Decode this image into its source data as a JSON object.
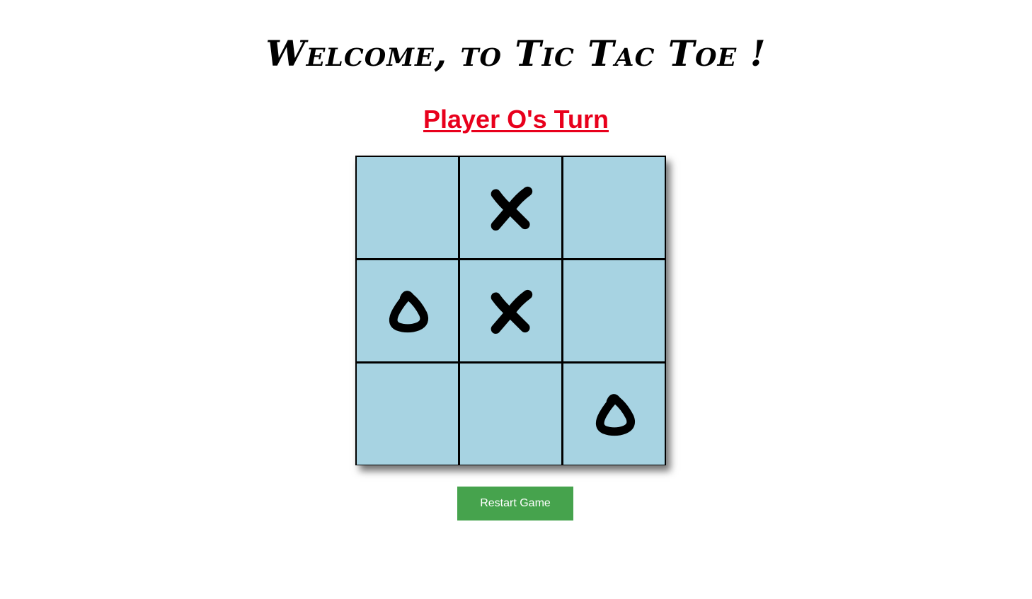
{
  "header": {
    "title": "Welcome, to Tic Tac Toe !"
  },
  "status": {
    "turn_text": "Player O's Turn",
    "turn_color": "#e8001c"
  },
  "board": {
    "cell_color": "#a7d3e2",
    "grid_color": "#000000",
    "cells": [
      "",
      "X",
      "",
      "O",
      "X",
      "",
      "",
      "",
      "O"
    ]
  },
  "controls": {
    "restart_label": "Restart Game",
    "restart_color": "#46a34d"
  }
}
